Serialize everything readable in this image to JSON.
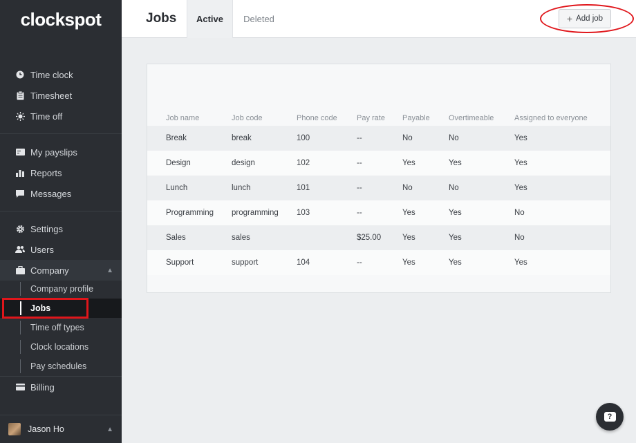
{
  "app": {
    "logo": "clockspot"
  },
  "sidebar": {
    "group1": [
      {
        "label": "Time clock",
        "icon": "clock-icon"
      },
      {
        "label": "Timesheet",
        "icon": "clipboard-icon"
      },
      {
        "label": "Time off",
        "icon": "sun-icon"
      }
    ],
    "group2": [
      {
        "label": "My payslips",
        "icon": "payslip-icon"
      },
      {
        "label": "Reports",
        "icon": "bar-chart-icon"
      },
      {
        "label": "Messages",
        "icon": "message-icon"
      }
    ],
    "group3": [
      {
        "label": "Settings",
        "icon": "gear-icon"
      },
      {
        "label": "Users",
        "icon": "users-icon"
      }
    ],
    "company": {
      "label": "Company",
      "icon": "briefcase-icon",
      "expanded": true
    },
    "company_items": [
      "Company profile",
      "Jobs",
      "Time off types",
      "Clock locations",
      "Pay schedules"
    ],
    "active_item": "Jobs",
    "billing": {
      "label": "Billing",
      "icon": "credit-card-icon"
    },
    "user": {
      "name": "Jason Ho"
    }
  },
  "header": {
    "title": "Jobs",
    "tabs": [
      {
        "label": "Active",
        "active": true
      },
      {
        "label": "Deleted",
        "active": false
      }
    ],
    "add_button": "Add job"
  },
  "table": {
    "columns": [
      "Job name",
      "Job code",
      "Phone code",
      "Pay rate",
      "Payable",
      "Overtimeable",
      "Assigned to everyone"
    ],
    "rows": [
      [
        "Break",
        "break",
        "100",
        "--",
        "No",
        "No",
        "Yes"
      ],
      [
        "Design",
        "design",
        "102",
        "--",
        "Yes",
        "Yes",
        "Yes"
      ],
      [
        "Lunch",
        "lunch",
        "101",
        "--",
        "No",
        "No",
        "Yes"
      ],
      [
        "Programming",
        "programming",
        "103",
        "--",
        "Yes",
        "Yes",
        "No"
      ],
      [
        "Sales",
        "sales",
        "",
        "$25.00",
        "Yes",
        "Yes",
        "No"
      ],
      [
        "Support",
        "support",
        "104",
        "--",
        "Yes",
        "Yes",
        "Yes"
      ]
    ]
  },
  "help": {
    "icon": "help-chat-icon",
    "glyph": "?"
  },
  "colors": {
    "sidebar_bg": "#2b2e33",
    "highlight_red": "#e0161b",
    "page_bg": "#eceef0"
  }
}
